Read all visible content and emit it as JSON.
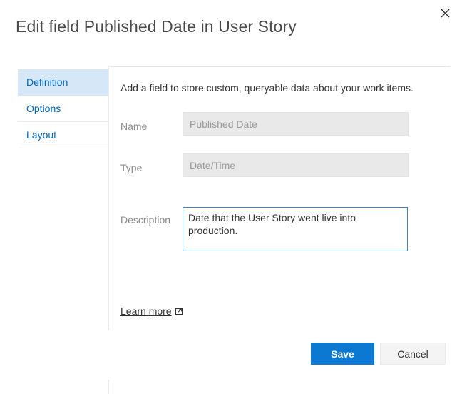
{
  "dialog": {
    "title": "Edit field Published Date in User Story",
    "close_icon": "close-icon"
  },
  "tabs": [
    {
      "label": "Definition",
      "selected": true
    },
    {
      "label": "Options",
      "selected": false
    },
    {
      "label": "Layout",
      "selected": false
    }
  ],
  "content": {
    "intro": "Add a field to store custom, queryable data about your work items.",
    "fields": {
      "name": {
        "label": "Name",
        "value": "Published Date",
        "placeholder": "Published Date",
        "disabled": true
      },
      "type": {
        "label": "Type",
        "value": "Date/Time",
        "placeholder": "Date/Time",
        "disabled": true
      },
      "description": {
        "label": "Description",
        "value": "Date that the User Story went live into production.",
        "placeholder": "",
        "focused": true
      }
    },
    "learn_more": {
      "label": "Learn more",
      "icon": "external-link-icon"
    }
  },
  "footer": {
    "save_label": "Save",
    "cancel_label": "Cancel"
  },
  "colors": {
    "accent": "#0b78d1",
    "tab_selected_bg": "#d6e7f7",
    "tab_text": "#0066bf",
    "field_bg": "#e9e9e9",
    "focus_border": "#3b86c4"
  }
}
